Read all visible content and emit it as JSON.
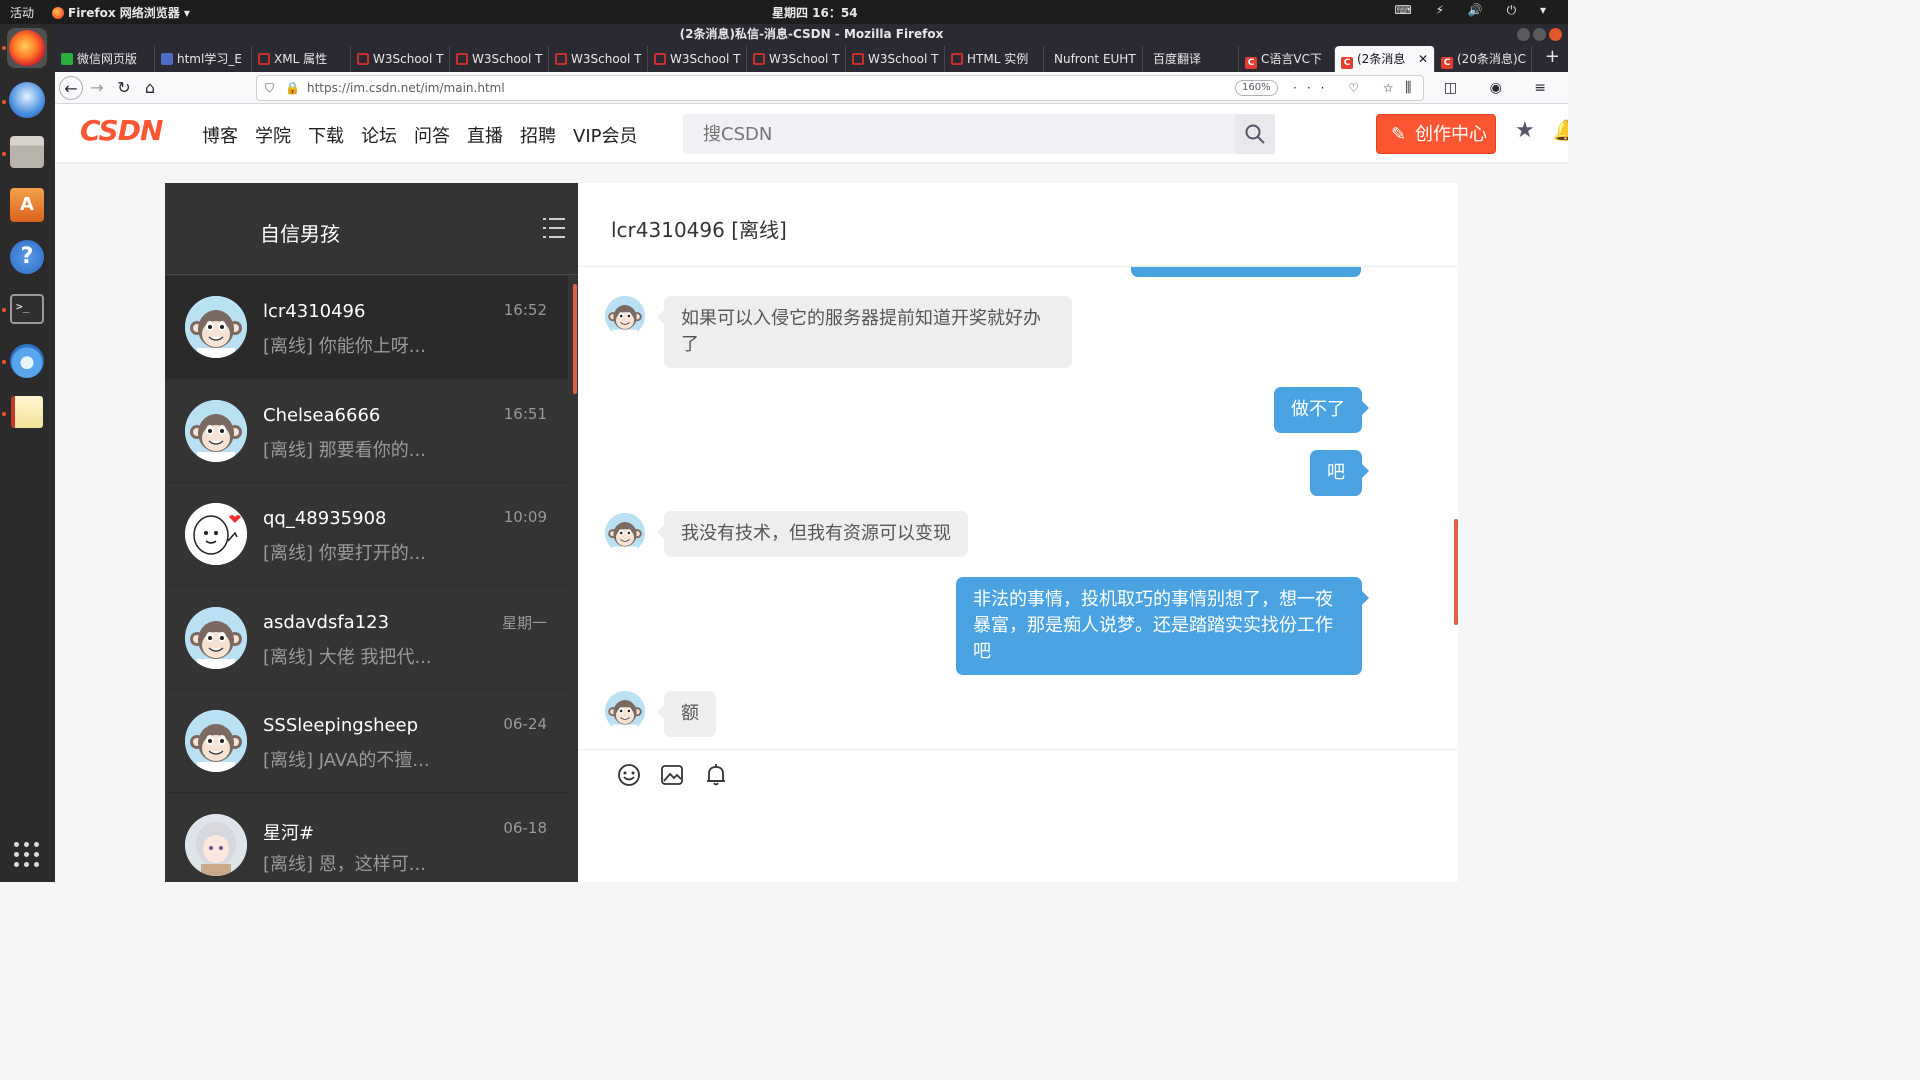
{
  "system": {
    "activities": "活动",
    "app_menu": "Firefox 网络浏览器 ▾",
    "clock": "星期四 16：54"
  },
  "window": {
    "title": "(2条消息)私信-消息-CSDN - Mozilla Firefox"
  },
  "tabs": [
    {
      "label": "微信网页版",
      "icon": "wechat-icon"
    },
    {
      "label": "html学习_E",
      "icon": "document-icon"
    },
    {
      "label": "XML 属性",
      "icon": "w3school-icon"
    },
    {
      "label": "W3School T",
      "icon": "w3school-icon"
    },
    {
      "label": "W3School T",
      "icon": "w3school-icon"
    },
    {
      "label": "W3School T",
      "icon": "w3school-icon"
    },
    {
      "label": "W3School T",
      "icon": "w3school-icon"
    },
    {
      "label": "W3School T",
      "icon": "w3school-icon"
    },
    {
      "label": "W3School T",
      "icon": "w3school-icon"
    },
    {
      "label": "HTML 实例",
      "icon": "w3school-icon"
    },
    {
      "label": "Nufront EUHT",
      "icon": "none"
    },
    {
      "label": "百度翻译",
      "icon": "none"
    },
    {
      "label": "C语言VC下",
      "icon": "csdn-icon"
    },
    {
      "label": "(2条消息",
      "icon": "csdn-icon",
      "active": true
    },
    {
      "label": "(20条消息)C",
      "icon": "csdn-icon"
    }
  ],
  "address": {
    "url": "https://im.csdn.net/im/main.html",
    "zoom": "160%"
  },
  "csdn": {
    "logo": "CSDN",
    "nav": [
      "博客",
      "学院",
      "下载",
      "论坛",
      "问答",
      "直播",
      "招聘",
      "VIP会员"
    ],
    "search_placeholder": "搜CSDN",
    "create_label": "创作中心",
    "brand_color": "#fc5531"
  },
  "chat": {
    "user_title": "自信男孩",
    "conversations": [
      {
        "name": "lcr4310496",
        "time": "16:52",
        "preview": "[离线] 你能你上呀...",
        "avatar": "monkey-avatar",
        "active": true
      },
      {
        "name": "Chelsea6666",
        "time": "16:51",
        "preview": "[离线] 那要看你的...",
        "avatar": "monkey-avatar"
      },
      {
        "name": "qq_48935908",
        "time": "10:09",
        "preview": "[离线] 你要打开的...",
        "avatar": "doodle-avatar"
      },
      {
        "name": "asdavdsfa123",
        "time": "星期一",
        "preview": "[离线] 大佬 我把代...",
        "avatar": "monkey-avatar"
      },
      {
        "name": "SSSleepingsheep",
        "time": "06-24",
        "preview": "[离线] JAVA的不擅...",
        "avatar": "monkey-avatar"
      },
      {
        "name": "星河#",
        "time": "06-18",
        "preview": "[离线] 恩，这样可...",
        "avatar": "anime-avatar"
      }
    ],
    "header": "lcr4310496 [离线]",
    "messages": [
      {
        "side": "left",
        "text": "如果可以入侵它的服务器提前知道开奖就好办了"
      },
      {
        "side": "right",
        "text": "做不了"
      },
      {
        "side": "right",
        "text": "吧"
      },
      {
        "side": "left",
        "text": "我没有技术，但我有资源可以变现"
      },
      {
        "side": "right",
        "text": "非法的事情，投机取巧的事情别想了，想一夜暴富，那是痴人说梦。还是踏踏实实找份工作吧"
      },
      {
        "side": "left",
        "text": "额"
      }
    ],
    "bubble_colors": {
      "mine": "#4aa3e0",
      "theirs": "#eeeeee"
    }
  }
}
